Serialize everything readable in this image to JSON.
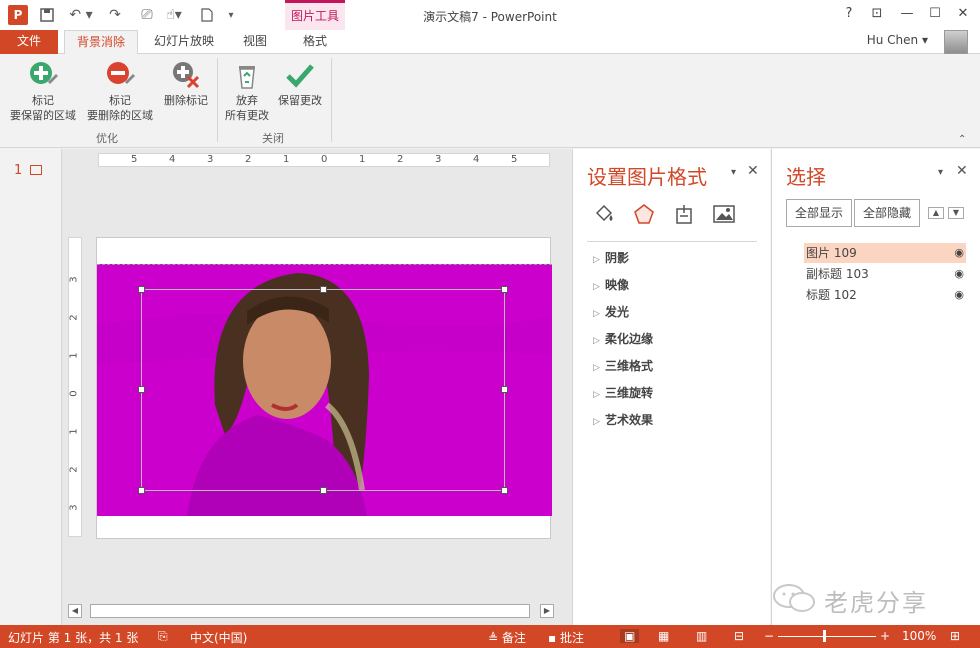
{
  "app": {
    "title": "演示文稿7 - PowerPoint",
    "icon_letter": "P",
    "context_tool_label": "图片工具",
    "user": "Hu Chen",
    "window_controls": [
      "?",
      "⊡",
      "—",
      "☐",
      "✕"
    ]
  },
  "tabs": {
    "file": "文件",
    "items": [
      "背景消除",
      "幻灯片放映",
      "视图",
      "格式"
    ],
    "active": "背景消除"
  },
  "ribbon": {
    "buttons": [
      {
        "icon": "plus-circle-icon",
        "line1": "标记",
        "line2": "要保留的区域"
      },
      {
        "icon": "minus-circle-icon",
        "line1": "标记",
        "line2": "要删除的区域"
      },
      {
        "icon": "delete-mark-icon",
        "line1": "删除标记",
        "line2": ""
      },
      {
        "icon": "recycle-bin-icon",
        "line1": "放弃",
        "line2": "所有更改"
      },
      {
        "icon": "checkmark-icon",
        "line1": "保留更改",
        "line2": ""
      }
    ],
    "groups": [
      "优化",
      "关闭"
    ]
  },
  "thumbnails": {
    "slide_number": "1"
  },
  "ruler": {
    "h_ticks": [
      "5",
      "4",
      "3",
      "2",
      "1",
      "0",
      "1",
      "2",
      "3",
      "4",
      "5"
    ],
    "v_ticks": [
      "3",
      "2",
      "1",
      "0",
      "1",
      "2",
      "3"
    ]
  },
  "format_pane": {
    "title": "设置图片格式",
    "tabs": [
      "fill-line-icon",
      "effects-icon",
      "size-properties-icon",
      "picture-icon"
    ],
    "sections": [
      "阴影",
      "映像",
      "发光",
      "柔化边缘",
      "三维格式",
      "三维旋转",
      "艺术效果"
    ]
  },
  "selection_pane": {
    "title": "选择",
    "show_all": "全部显示",
    "hide_all": "全部隐藏",
    "items": [
      {
        "label": "图片 109",
        "active": true
      },
      {
        "label": "副标题 103",
        "active": false
      },
      {
        "label": "标题 102",
        "active": false
      }
    ],
    "watermark": "老虎分享"
  },
  "status_bar": {
    "slide_info": "幻灯片 第 1 张，共 1 张",
    "language": "中文(中国)",
    "notes": "备注",
    "comments": "批注",
    "zoom": "100%"
  },
  "colors": {
    "accent": "#d24726",
    "removal_overlay": "#cc00cc",
    "selected_row": "#fcd5c2"
  }
}
